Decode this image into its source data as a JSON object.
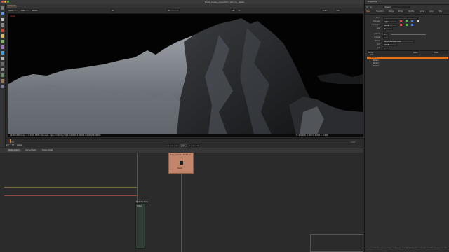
{
  "window": {
    "title": "Nuke_lonely_mountain_v01.nk - Nuke"
  },
  "toolbar": {
    "tools": [
      "viewer-icon",
      "read-icon",
      "draw-icon",
      "time-icon",
      "channel-icon",
      "color-icon",
      "filter-icon",
      "keyer-icon",
      "merge-icon",
      "transform-icon",
      "3d-icon",
      "views-icon",
      "metadata-icon",
      "toolsets-icon",
      "other-icon"
    ]
  },
  "viewer": {
    "tab_label": "Viewer1",
    "controls": {
      "channels": "rgba",
      "channel_sel": "rgba",
      "colorspace": "sRGB",
      "input_a": "A",
      "input_b": "B",
      "gain_label": "f/8",
      "gamma_label": "y",
      "zoom": "1:1",
      "res": "2K"
    },
    "info_bar": "2048x1080 bbox: 0 0 2048 1080 channels: rgba  x=1024 y=540   0.00000  0.00000  0.00000  0.00000",
    "info_right": "H: 0.000 S: 0.000 V: 0.000 L: 0.000",
    "frame_label": "1001"
  },
  "timeline": {
    "start": "1001",
    "end": "1100",
    "current": "1001",
    "fps": "24*",
    "tf_label": "TF",
    "global_label": "Global"
  },
  "node_graph": {
    "tabs": [
      "Node Graph",
      "Curve Editor",
      "Dope Sheet"
    ],
    "node_read": {
      "title": "lonely_mountain.####.exr",
      "label": "Read1"
    },
    "node_write": {
      "title": "NF Nodes Node",
      "label": "Write1"
    }
  },
  "properties": {
    "tab": "Properties",
    "panel_tabs": [
      "Read",
      "Transform",
      "Merge",
      "Write",
      "Shuffle",
      "Grade",
      "Color",
      "Blur"
    ],
    "node_name": "Viewer1",
    "rows": [
      {
        "label": "input",
        "value": ""
      },
      {
        "label": "channels",
        "value": "rgba"
      },
      {
        "label": "colorspace",
        "value": "sRGB"
      },
      {
        "label": "gain",
        "value": "1"
      },
      {
        "label": "gamma",
        "value": "1"
      },
      {
        "label": "cliptest",
        "value": ""
      },
      {
        "label": "format",
        "value": "2K_DCP 2048x1080"
      },
      {
        "label": "LUT",
        "value": "sRGB"
      },
      {
        "label": "grid",
        "value": ""
      },
      {
        "label": "overlay",
        "value": "none"
      }
    ],
    "layers_header": [
      "Name",
      "Value",
      "Color"
    ],
    "layers": [
      {
        "name": "Root",
        "selected": false
      },
      {
        "name": "Layer1",
        "selected": true
      },
      {
        "name": "Bezier1",
        "selected": false
      },
      {
        "name": "Bezier2",
        "selected": false
      },
      {
        "name": "Bezier3",
        "selected": false
      }
    ]
  },
  "status": {
    "text": "Channel Count: 12/1024 Localization Mode: On  Memory: 10.2 GB (64.7%)  CPU: 5.0%  Disk: 14.4 MB/s  Network: 0.0 MB/s"
  },
  "colors": {
    "accent": "#f08a24",
    "selection": "#e4731a",
    "node_read": "#c1866b",
    "node_write": "#2f3d35"
  }
}
